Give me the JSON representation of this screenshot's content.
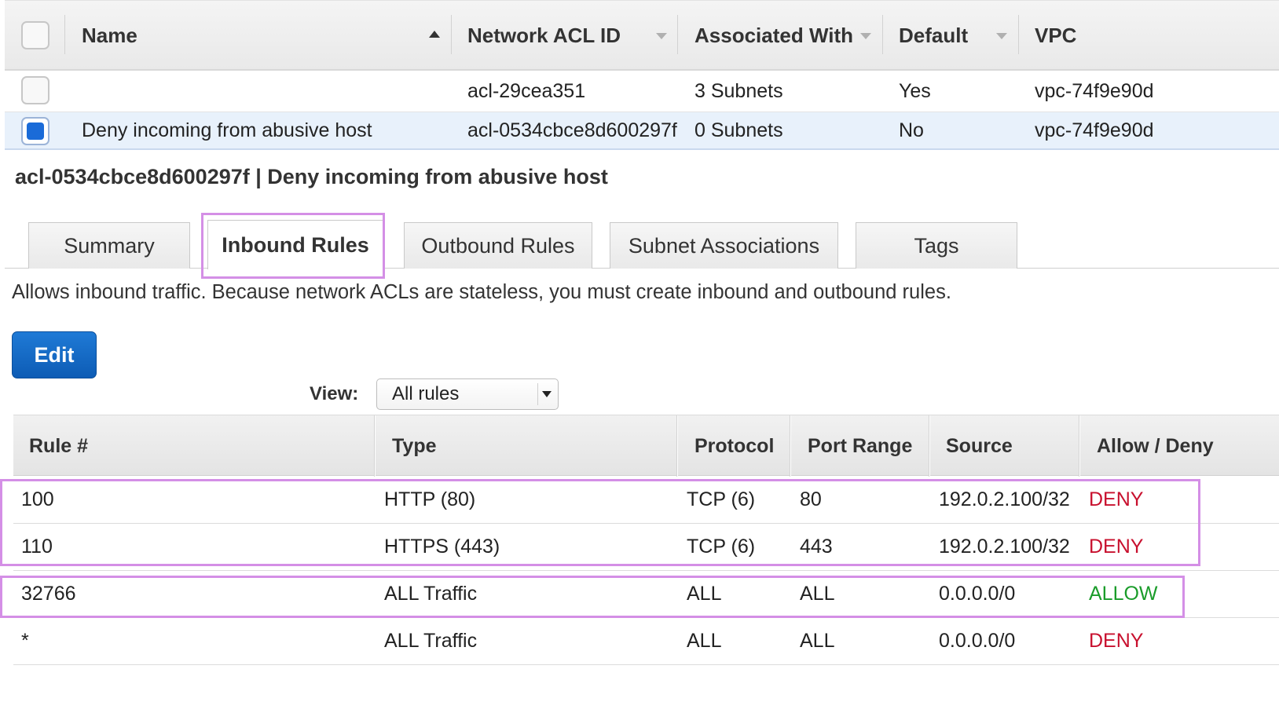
{
  "acl_table": {
    "headers": {
      "name": "Name",
      "acl_id": "Network ACL ID",
      "associated": "Associated With",
      "default": "Default",
      "vpc": "VPC"
    },
    "rows": [
      {
        "selected": false,
        "name": "",
        "acl_id": "acl-29cea351",
        "associated": "3 Subnets",
        "default": "Yes",
        "vpc": "vpc-74f9e90d"
      },
      {
        "selected": true,
        "name": "Deny incoming from abusive host",
        "acl_id": "acl-0534cbce8d600297f",
        "associated": "0 Subnets",
        "default": "No",
        "vpc": "vpc-74f9e90d"
      }
    ]
  },
  "detail": {
    "title": "acl-0534cbce8d600297f | Deny incoming from abusive host",
    "tabs": [
      "Summary",
      "Inbound Rules",
      "Outbound Rules",
      "Subnet Associations",
      "Tags"
    ],
    "active_tab": "Inbound Rules",
    "description": "Allows inbound traffic. Because network ACLs are stateless, you must create inbound and outbound rules.",
    "edit_label": "Edit",
    "view_label": "View:",
    "view_value": "All rules"
  },
  "rules_table": {
    "headers": {
      "rule": "Rule #",
      "type": "Type",
      "protocol": "Protocol",
      "port": "Port Range",
      "source": "Source",
      "action": "Allow / Deny"
    },
    "rows": [
      {
        "rule": "100",
        "type": "HTTP (80)",
        "protocol": "TCP (6)",
        "port": "80",
        "source": "192.0.2.100/32",
        "action": "DENY"
      },
      {
        "rule": "110",
        "type": "HTTPS (443)",
        "protocol": "TCP (6)",
        "port": "443",
        "source": "192.0.2.100/32",
        "action": "DENY"
      },
      {
        "rule": "32766",
        "type": "ALL Traffic",
        "protocol": "ALL",
        "port": "ALL",
        "source": "0.0.0.0/0",
        "action": "ALLOW"
      },
      {
        "rule": "*",
        "type": "ALL Traffic",
        "protocol": "ALL",
        "port": "ALL",
        "source": "0.0.0.0/0",
        "action": "DENY"
      }
    ]
  },
  "colors": {
    "deny": "#c8102e",
    "allow": "#1a9c2a",
    "highlight": "#d48fe6",
    "primary": "#0d5cb5"
  }
}
